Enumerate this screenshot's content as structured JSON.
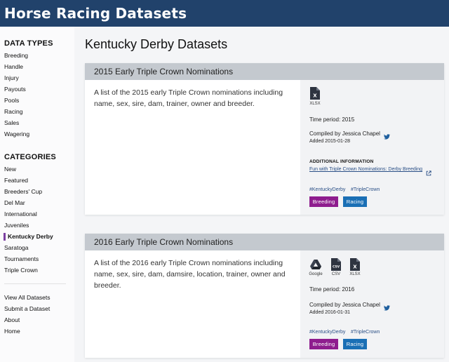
{
  "app": {
    "brand": "Horse Racing Datasets"
  },
  "sidebar": {
    "data_types_heading": "DATA TYPES",
    "data_types": [
      "Breeding",
      "Handle",
      "Injury",
      "Payouts",
      "Pools",
      "Racing",
      "Sales",
      "Wagering"
    ],
    "categories_heading": "CATEGORIES",
    "categories": [
      "New",
      "Featured",
      "Breeders' Cup",
      "Del Mar",
      "International",
      "Juveniles",
      "Kentucky Derby",
      "Saratoga",
      "Tournaments",
      "Triple Crown"
    ],
    "active_category": "Kentucky Derby",
    "links": [
      "View All Datasets",
      "Submit a Dataset",
      "About",
      "Home"
    ]
  },
  "main": {
    "title": "Kentucky Derby Datasets",
    "datasets": [
      {
        "title": "2015 Early Triple Crown Nominations",
        "description": "A list of the 2015 early Triple Crown nominations including name, sex, sire, dam, trainer, owner and breeder.",
        "formats": [
          "XLSX"
        ],
        "time_period": "Time period: 2015",
        "compiled_by": "Compiled by Jessica Chapel",
        "added": "Added 2015-01-28",
        "additional_heading": "ADDITIONAL INFORMATION",
        "additional_link": "Fun with Triple Crown Nominations: Derby Breeding",
        "tags": [
          "#KentuckyDerby",
          "#TripleCrown"
        ],
        "badges": [
          {
            "label": "Breeding",
            "color": "#8e1d8e"
          },
          {
            "label": "Racing",
            "color": "#1a6fb5"
          }
        ]
      },
      {
        "title": "2016 Early Triple Crown Nominations",
        "description": "A list of the 2016 early Triple Crown nominations including name, sex, sire, dam, damsire, location, trainer, owner and breeder.",
        "formats": [
          "Google",
          "CSV",
          "XLSX"
        ],
        "time_period": "Time period: 2016",
        "compiled_by": "Compiled by Jessica Chapel",
        "added": "Added 2016-01-31",
        "tags": [
          "#KentuckyDerby",
          "#TripleCrown"
        ],
        "badges": [
          {
            "label": "Breeding",
            "color": "#8e1d8e"
          },
          {
            "label": "Racing",
            "color": "#1a6fb5"
          }
        ]
      }
    ]
  },
  "colors": {
    "topbar": "#21426b",
    "card_header": "#c4c9cf",
    "active_marker": "#7b3fa0",
    "link": "#2a4f86",
    "twitter": "#1f5f9e"
  }
}
